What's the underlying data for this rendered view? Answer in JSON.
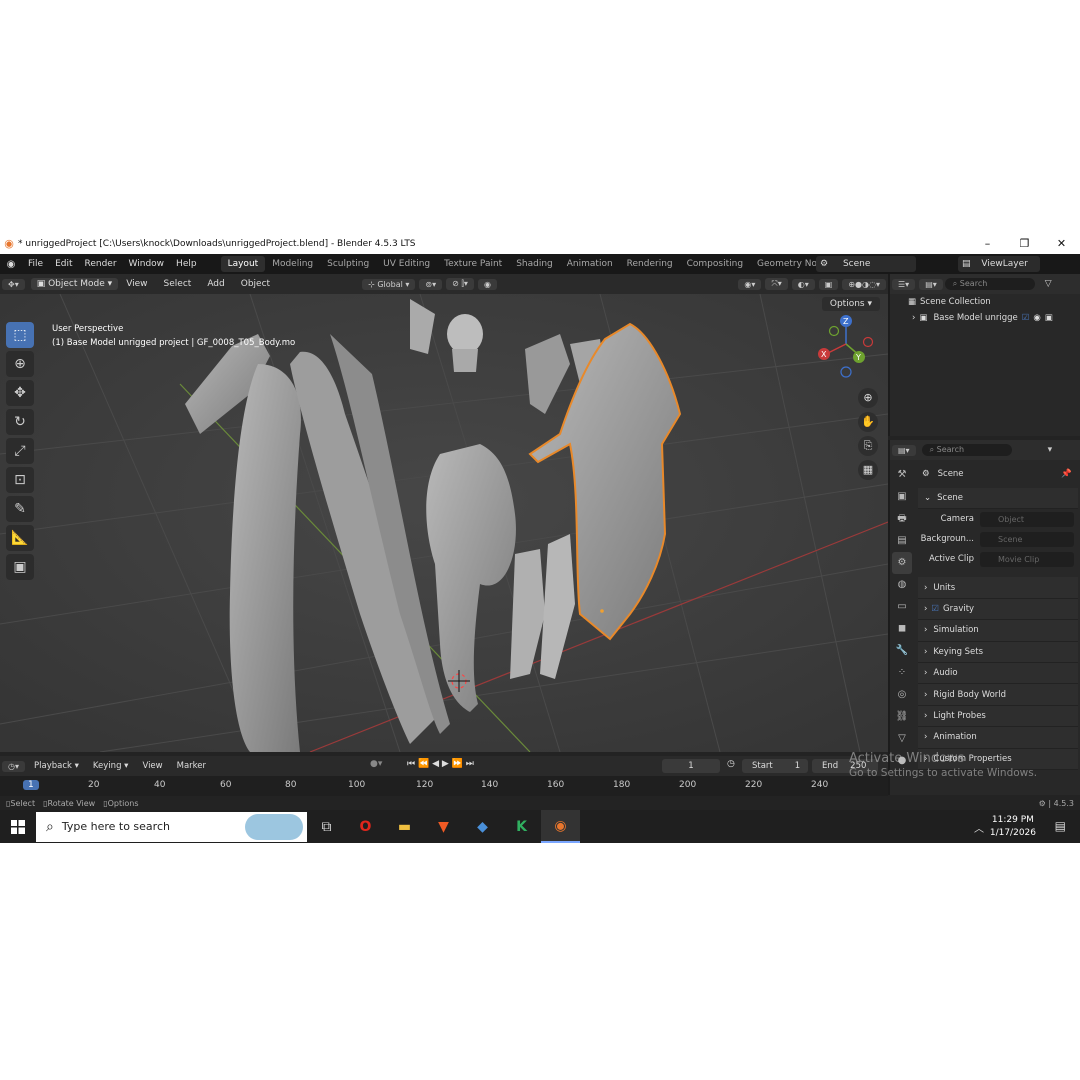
{
  "window": {
    "title": "* unriggedProject [C:\\Users\\knock\\Downloads\\unriggedProject.blend] - Blender 4.5.3 LTS",
    "controls": [
      "–",
      "❐",
      "✕"
    ]
  },
  "menubar": {
    "items": [
      "File",
      "Edit",
      "Render",
      "Window",
      "Help"
    ],
    "workspaces": [
      "Layout",
      "Modeling",
      "Sculpting",
      "UV Editing",
      "Texture Paint",
      "Shading",
      "Animation",
      "Rendering",
      "Compositing",
      "Geometry Node"
    ],
    "active_workspace": "Layout",
    "scene": "Scene",
    "view_layer": "ViewLayer"
  },
  "viewport_header": {
    "mode": "Object Mode",
    "menus": [
      "View",
      "Select",
      "Add",
      "Object"
    ],
    "transform": "Global",
    "options": "Options"
  },
  "viewport": {
    "perspective": "User Perspective",
    "object_info": "(1) Base Model  unrigged  project | GF_0008_T05_Body.mo",
    "gizmo_axes": [
      "X",
      "Y",
      "Z"
    ]
  },
  "outliner": {
    "search_placeholder": "Search",
    "collection": "Scene Collection",
    "item": "Base Model  unrigge"
  },
  "properties": {
    "search_placeholder": "Search",
    "context": "Scene",
    "section": "Scene",
    "fields": [
      {
        "label": "Camera",
        "value": "Object"
      },
      {
        "label": "Backgroun...",
        "value": "Scene"
      },
      {
        "label": "Active Clip",
        "value": "Movie Clip"
      }
    ],
    "panels": [
      "Units",
      "Gravity",
      "Simulation",
      "Keying Sets",
      "Audio",
      "Rigid Body World",
      "Light Probes",
      "Animation",
      "Custom Properties"
    ]
  },
  "timeline": {
    "menus": [
      "Playback",
      "Keying",
      "View",
      "Marker"
    ],
    "current_frame": "1",
    "start_label": "Start",
    "start": "1",
    "end_label": "End",
    "end": "250",
    "ticks": [
      "1",
      "20",
      "40",
      "60",
      "80",
      "100",
      "120",
      "140",
      "160",
      "180",
      "200",
      "220",
      "240"
    ]
  },
  "statusbar": {
    "hints": [
      "Select",
      "Rotate View",
      "Options"
    ],
    "version": "4.5.3"
  },
  "watermark": {
    "line1": "Activate Windows",
    "line2": "Go to Settings to activate Windows."
  },
  "taskbar": {
    "search_placeholder": "Type here to search",
    "time": "11:29 PM",
    "date": "1/17/2026"
  }
}
